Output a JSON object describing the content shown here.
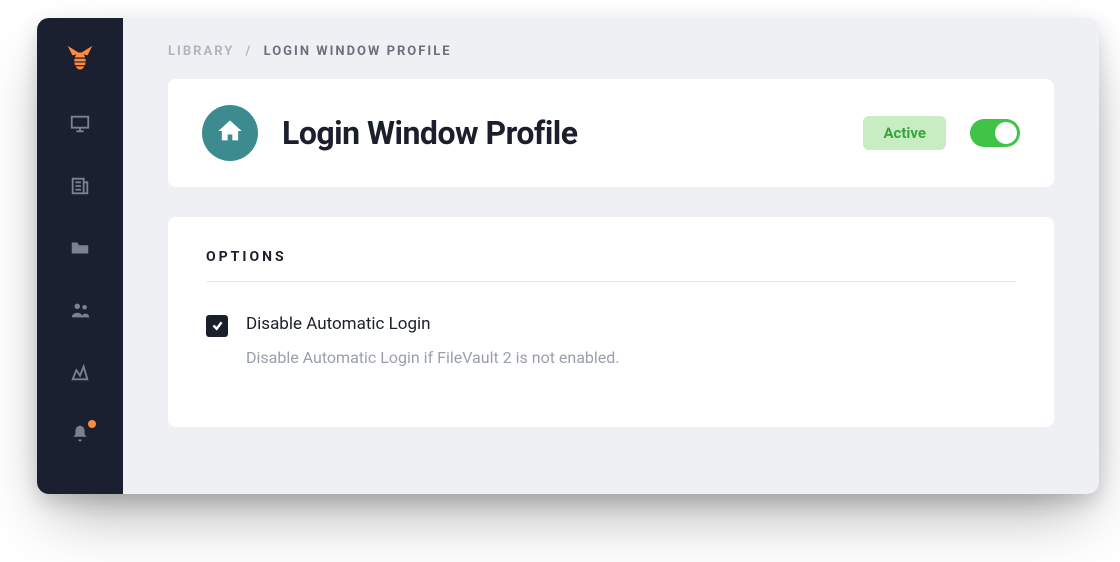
{
  "breadcrumb": {
    "seg1": "LIBRARY",
    "separator": "/",
    "seg2": "LOGIN WINDOW PROFILE"
  },
  "header": {
    "title": "Login Window Profile",
    "status_label": "Active",
    "toggle_on": true
  },
  "options": {
    "heading": "OPTIONS",
    "items": [
      {
        "checked": true,
        "label": "Disable Automatic Login",
        "description": "Disable Automatic Login if FileVault 2 is not enabled."
      }
    ]
  },
  "sidebar": {
    "items": [
      {
        "name": "monitor"
      },
      {
        "name": "news"
      },
      {
        "name": "folder"
      },
      {
        "name": "users"
      },
      {
        "name": "analytics"
      },
      {
        "name": "bell"
      }
    ]
  },
  "colors": {
    "sidebar_bg": "#1a2030",
    "accent_green": "#3fc447",
    "badge_bg": "#c8edc2",
    "badge_text": "#36a53d",
    "icon_circle": "#3b8b8f",
    "brand_orange": "#ff8a3d"
  }
}
